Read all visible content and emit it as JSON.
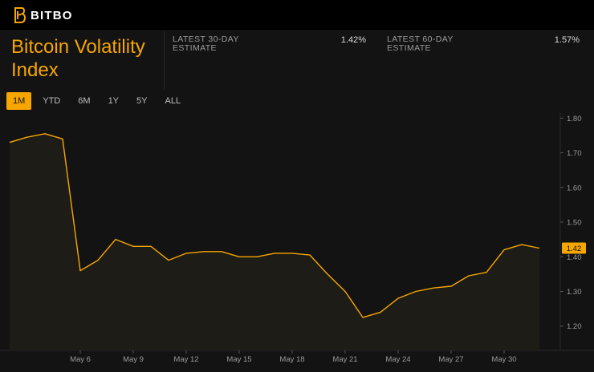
{
  "header": {
    "brand": "BITBO"
  },
  "page_title": "Bitcoin Volatility Index",
  "estimates": [
    {
      "label": "LATEST 30-DAY ESTIMATE",
      "value": "1.42%"
    },
    {
      "label": "LATEST 60-DAY ESTIMATE",
      "value": "1.57%"
    }
  ],
  "ranges": [
    {
      "label": "1M",
      "active": true
    },
    {
      "label": "YTD",
      "active": false
    },
    {
      "label": "6M",
      "active": false
    },
    {
      "label": "1Y",
      "active": false
    },
    {
      "label": "5Y",
      "active": false
    },
    {
      "label": "ALL",
      "active": false
    }
  ],
  "colors": {
    "accent": "#f7a600",
    "background": "#131313"
  },
  "chart_data": {
    "type": "area",
    "title": "",
    "xlabel": "",
    "ylabel": "",
    "ylim": [
      1.13,
      1.81
    ],
    "y_ticks": [
      "1.80",
      "1.70",
      "1.60",
      "1.50",
      "1.40",
      "1.30",
      "1.20"
    ],
    "x_tick_labels": [
      "May 6",
      "May 9",
      "May 12",
      "May 15",
      "May 18",
      "May 21",
      "May 24",
      "May 27",
      "May 30"
    ],
    "x_tick_positions": [
      4,
      7,
      10,
      13,
      16,
      19,
      22,
      25,
      28
    ],
    "x_range": [
      0,
      30
    ],
    "grid": false,
    "last_value_label": "1.42",
    "series": [
      {
        "x": [
          0,
          1,
          2,
          3,
          4,
          5,
          6,
          7,
          8,
          9,
          10,
          11,
          12,
          13,
          14,
          15,
          16,
          17,
          18,
          19,
          20,
          21,
          22,
          23,
          24,
          25,
          26,
          27,
          28,
          29,
          30
        ],
        "values": [
          1.73,
          1.745,
          1.755,
          1.74,
          1.36,
          1.39,
          1.45,
          1.43,
          1.43,
          1.39,
          1.41,
          1.415,
          1.415,
          1.4,
          1.4,
          1.41,
          1.41,
          1.405,
          1.35,
          1.3,
          1.225,
          1.24,
          1.28,
          1.3,
          1.31,
          1.315,
          1.345,
          1.355,
          1.42,
          1.435,
          1.425
        ]
      }
    ]
  }
}
